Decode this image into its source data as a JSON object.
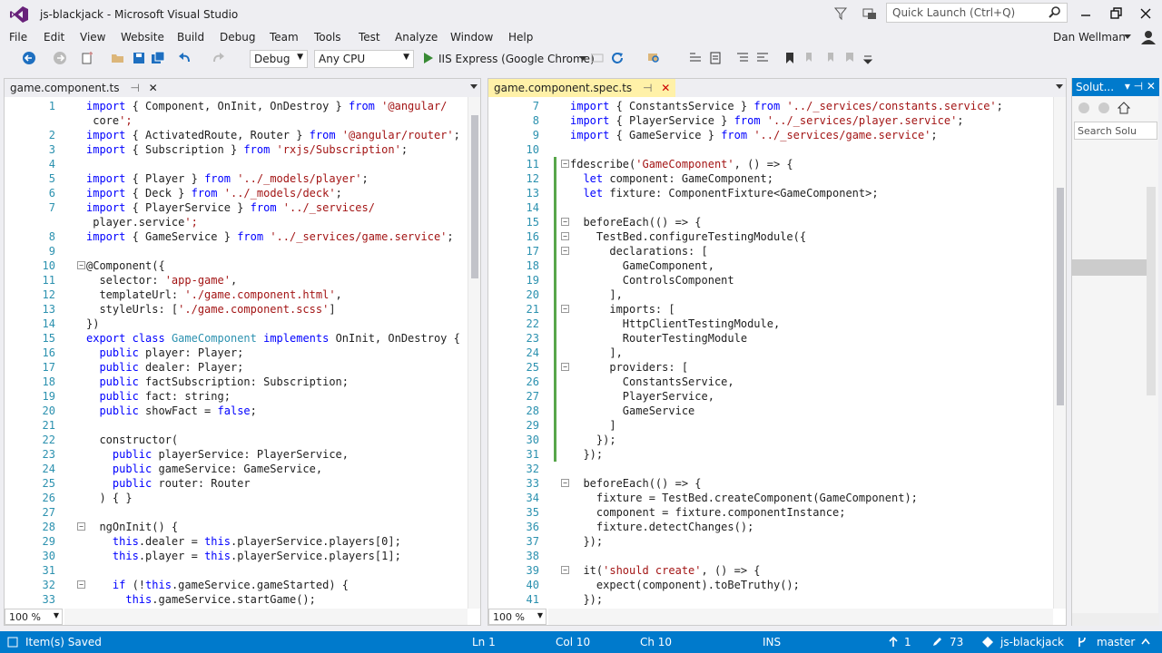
{
  "window": {
    "title": "js-blackjack - Microsoft Visual Studio",
    "quick_launch_placeholder": "Quick Launch (Ctrl+Q)"
  },
  "menu": [
    "File",
    "Edit",
    "View",
    "Website",
    "Build",
    "Debug",
    "Team",
    "Tools",
    "Test",
    "Analyze",
    "Window",
    "Help"
  ],
  "user": "Dan Wellman",
  "toolbar": {
    "config": "Debug",
    "platform": "Any CPU",
    "run_target": "IIS Express (Google Chrome)"
  },
  "colors": {
    "accent": "#007acc",
    "keyword": "#0000ff",
    "string": "#a31515",
    "type": "#2b91af",
    "change_bar": "#57a64a"
  },
  "left_pane": {
    "tab": "game.component.ts",
    "zoom": "100 %",
    "lines": [
      {
        "n": "1",
        "t": "import { Component, OnInit, OnDestroy } from '@angular/"
      },
      {
        "n": "",
        "t": " core';"
      },
      {
        "n": "2",
        "t": "import { ActivatedRoute, Router } from '@angular/router';"
      },
      {
        "n": "3",
        "t": "import { Subscription } from 'rxjs/Subscription';"
      },
      {
        "n": "4",
        "t": ""
      },
      {
        "n": "5",
        "t": "import { Player } from '../_models/player';"
      },
      {
        "n": "6",
        "t": "import { Deck } from '../_models/deck';"
      },
      {
        "n": "7",
        "t": "import { PlayerService } from '../_services/"
      },
      {
        "n": "",
        "t": " player.service';"
      },
      {
        "n": "8",
        "t": "import { GameService } from '../_services/game.service';"
      },
      {
        "n": "9",
        "t": ""
      },
      {
        "n": "10",
        "t": "@Component({"
      },
      {
        "n": "11",
        "t": "  selector: 'app-game',"
      },
      {
        "n": "12",
        "t": "  templateUrl: './game.component.html',"
      },
      {
        "n": "13",
        "t": "  styleUrls: ['./game.component.scss']"
      },
      {
        "n": "14",
        "t": "})"
      },
      {
        "n": "15",
        "t": "export class GameComponent implements OnInit, OnDestroy {"
      },
      {
        "n": "16",
        "t": "  public player: Player;"
      },
      {
        "n": "17",
        "t": "  public dealer: Player;"
      },
      {
        "n": "18",
        "t": "  public factSubscription: Subscription;"
      },
      {
        "n": "19",
        "t": "  public fact: string;"
      },
      {
        "n": "20",
        "t": "  public showFact = false;"
      },
      {
        "n": "21",
        "t": ""
      },
      {
        "n": "22",
        "t": "  constructor("
      },
      {
        "n": "23",
        "t": "    public playerService: PlayerService,"
      },
      {
        "n": "24",
        "t": "    public gameService: GameService,"
      },
      {
        "n": "25",
        "t": "    public router: Router"
      },
      {
        "n": "26",
        "t": "  ) { }"
      },
      {
        "n": "27",
        "t": ""
      },
      {
        "n": "28",
        "t": "  ngOnInit() {"
      },
      {
        "n": "29",
        "t": "    this.dealer = this.playerService.players[0];"
      },
      {
        "n": "30",
        "t": "    this.player = this.playerService.players[1];"
      },
      {
        "n": "31",
        "t": ""
      },
      {
        "n": "32",
        "t": "    if (!this.gameService.gameStarted) {"
      },
      {
        "n": "33",
        "t": "      this.gameService.startGame();"
      }
    ]
  },
  "right_pane": {
    "tab": "game.component.spec.ts",
    "zoom": "100 %",
    "lines": [
      {
        "n": "7",
        "t": "import { ConstantsService } from '../_services/constants.service';"
      },
      {
        "n": "8",
        "t": "import { PlayerService } from '../_services/player.service';"
      },
      {
        "n": "9",
        "t": "import { GameService } from '../_services/game.service';"
      },
      {
        "n": "10",
        "t": ""
      },
      {
        "n": "11",
        "t": "fdescribe('GameComponent', () => {"
      },
      {
        "n": "12",
        "t": "  let component: GameComponent;"
      },
      {
        "n": "13",
        "t": "  let fixture: ComponentFixture<GameComponent>;"
      },
      {
        "n": "14",
        "t": ""
      },
      {
        "n": "15",
        "t": "  beforeEach(() => {"
      },
      {
        "n": "16",
        "t": "    TestBed.configureTestingModule({"
      },
      {
        "n": "17",
        "t": "      declarations: ["
      },
      {
        "n": "18",
        "t": "        GameComponent,"
      },
      {
        "n": "19",
        "t": "        ControlsComponent"
      },
      {
        "n": "20",
        "t": "      ],"
      },
      {
        "n": "21",
        "t": "      imports: ["
      },
      {
        "n": "22",
        "t": "        HttpClientTestingModule,"
      },
      {
        "n": "23",
        "t": "        RouterTestingModule"
      },
      {
        "n": "24",
        "t": "      ],"
      },
      {
        "n": "25",
        "t": "      providers: ["
      },
      {
        "n": "26",
        "t": "        ConstantsService,"
      },
      {
        "n": "27",
        "t": "        PlayerService,"
      },
      {
        "n": "28",
        "t": "        GameService"
      },
      {
        "n": "29",
        "t": "      ]"
      },
      {
        "n": "30",
        "t": "    });"
      },
      {
        "n": "31",
        "t": "  });"
      },
      {
        "n": "32",
        "t": ""
      },
      {
        "n": "33",
        "t": "  beforeEach(() => {"
      },
      {
        "n": "34",
        "t": "    fixture = TestBed.createComponent(GameComponent);"
      },
      {
        "n": "35",
        "t": "    component = fixture.componentInstance;"
      },
      {
        "n": "36",
        "t": "    fixture.detectChanges();"
      },
      {
        "n": "37",
        "t": "  });"
      },
      {
        "n": "38",
        "t": ""
      },
      {
        "n": "39",
        "t": "  it('should create', () => {"
      },
      {
        "n": "40",
        "t": "    expect(component).toBeTruthy();"
      },
      {
        "n": "41",
        "t": "  });"
      }
    ]
  },
  "solution": {
    "title": "Solut...",
    "search_placeholder": "Search Solu"
  },
  "status": {
    "message": "Item(s) Saved",
    "ln": "Ln 1",
    "col": "Col 10",
    "ch": "Ch 10",
    "mode": "INS",
    "up": "1",
    "changes": "73",
    "repo": "js-blackjack",
    "branch": "master"
  }
}
